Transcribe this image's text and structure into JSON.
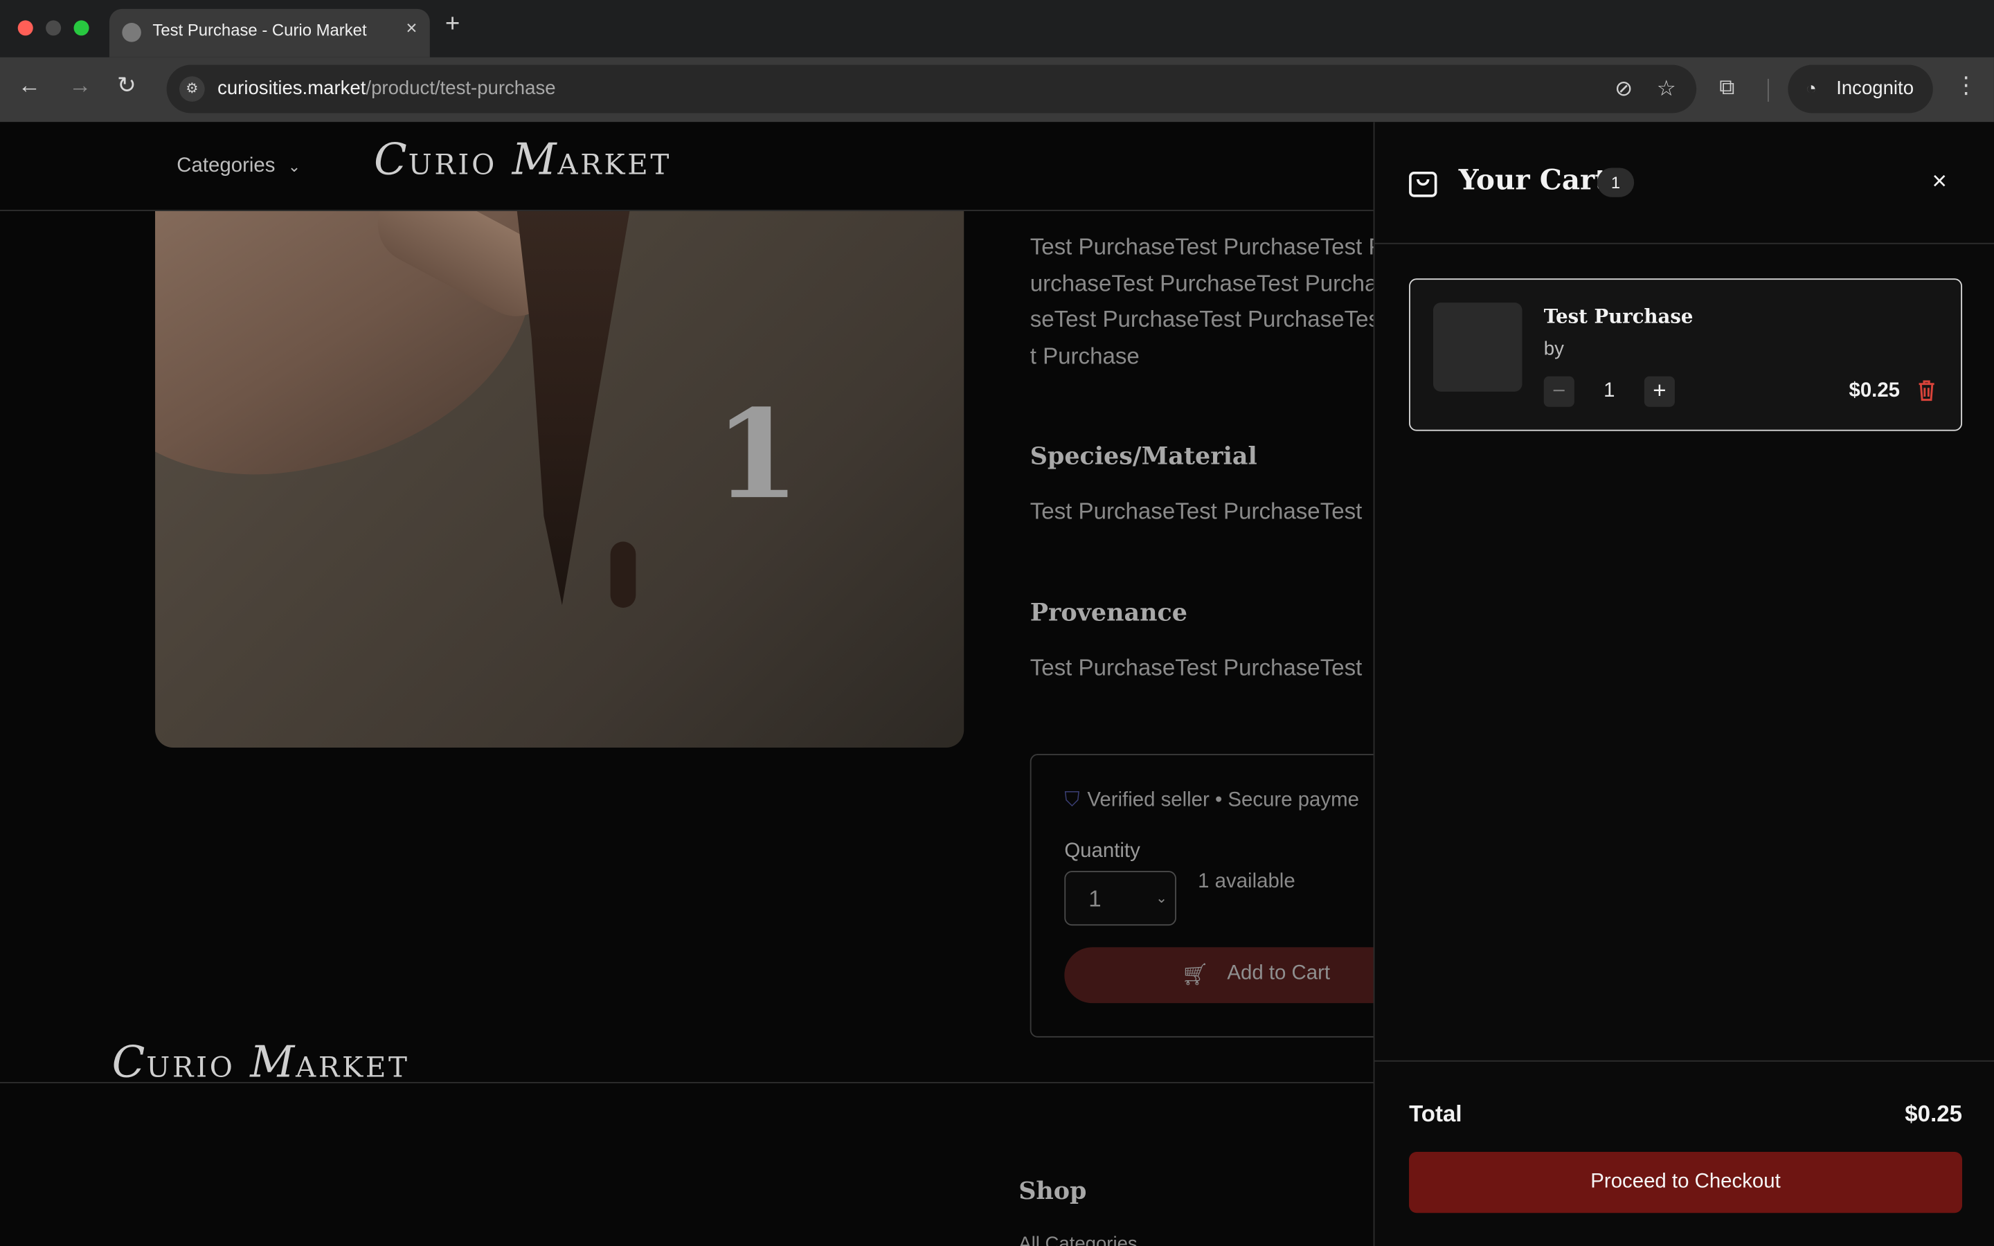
{
  "browser": {
    "tab_title": "Test Purchase - Curio Market",
    "tab_close": "×",
    "new_tab": "+",
    "url_host": "curiosities.market",
    "url_path": "/product/test-purchase",
    "incognito_label": "Incognito"
  },
  "header": {
    "categories_label": "Categories",
    "logo_initial_1": "C",
    "logo_rest_1": "URIO",
    "logo_initial_2": "M",
    "logo_rest_2": "ARKET"
  },
  "product": {
    "image_overlay_number": "1",
    "description": "Test PurchaseTest PurchaseTest PurchaseTest PurchaseTest PurchaseTest PurchaseTest PurchaseTest Purchase",
    "species_title": "Species/Material",
    "species_text": "Test PurchaseTest PurchaseTest",
    "provenance_title": "Provenance",
    "provenance_text": "Test PurchaseTest PurchaseTest"
  },
  "buybox": {
    "verified_text": "Verified seller • Secure payme",
    "quantity_label": "Quantity",
    "quantity_value": "1",
    "available_text": "1 available",
    "add_to_cart_label": "Add to Cart"
  },
  "footer": {
    "shop_title": "Shop",
    "shop_link": "All Categories"
  },
  "cart": {
    "title": "Your Cart",
    "count": "1",
    "close": "×",
    "items": [
      {
        "name": "Test Purchase",
        "by": "by",
        "quantity": "1",
        "minus": "−",
        "plus": "+",
        "price": "$0.25"
      }
    ],
    "total_label": "Total",
    "total_value": "$0.25",
    "checkout_label": "Proceed to Checkout"
  },
  "colors": {
    "accent": "#6e1512",
    "trash": "#d9433a",
    "shield": "#3b3f75"
  }
}
